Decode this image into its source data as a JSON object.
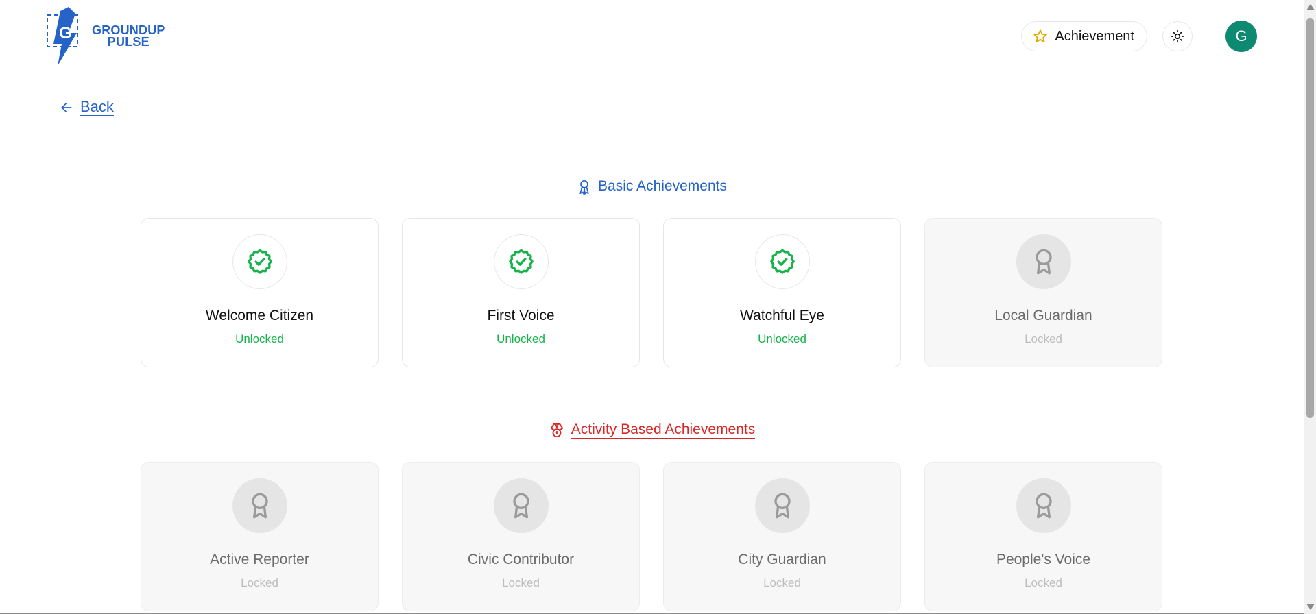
{
  "brand": {
    "logo_letter": "G",
    "line1": "GROUNDUP",
    "line2": "PULSE",
    "color": "#2563c9"
  },
  "header": {
    "achievement_label": "Achievement",
    "achievement_icon": "star-icon",
    "theme_icon": "sun-icon",
    "avatar_initial": "G",
    "avatar_color": "#0f8a72"
  },
  "back": {
    "label": "Back",
    "icon": "arrow-left-icon"
  },
  "sections": {
    "basic": {
      "title": "Basic Achievements",
      "icon": "ribbon-icon",
      "color": "#2563c9",
      "cards": [
        {
          "name": "Welcome Citizen",
          "status": "Unlocked",
          "icon": "badge-check-icon"
        },
        {
          "name": "First Voice",
          "status": "Unlocked",
          "icon": "badge-check-icon"
        },
        {
          "name": "Watchful Eye",
          "status": "Unlocked",
          "icon": "badge-check-icon"
        },
        {
          "name": "Local Guardian",
          "status": "Locked",
          "icon": "award-icon"
        }
      ]
    },
    "activity": {
      "title": "Activity Based Achievements",
      "icon": "medal-icon",
      "color": "#dc2626",
      "cards": [
        {
          "name": "Active Reporter",
          "status": "Locked",
          "icon": "award-icon"
        },
        {
          "name": "Civic Contributor",
          "status": "Locked",
          "icon": "award-icon"
        },
        {
          "name": "City Guardian",
          "status": "Locked",
          "icon": "award-icon"
        },
        {
          "name": "People's Voice",
          "status": "Locked",
          "icon": "award-icon"
        }
      ]
    }
  },
  "colors": {
    "unlocked": "#16b34a",
    "locked": "#bdbdbd"
  }
}
